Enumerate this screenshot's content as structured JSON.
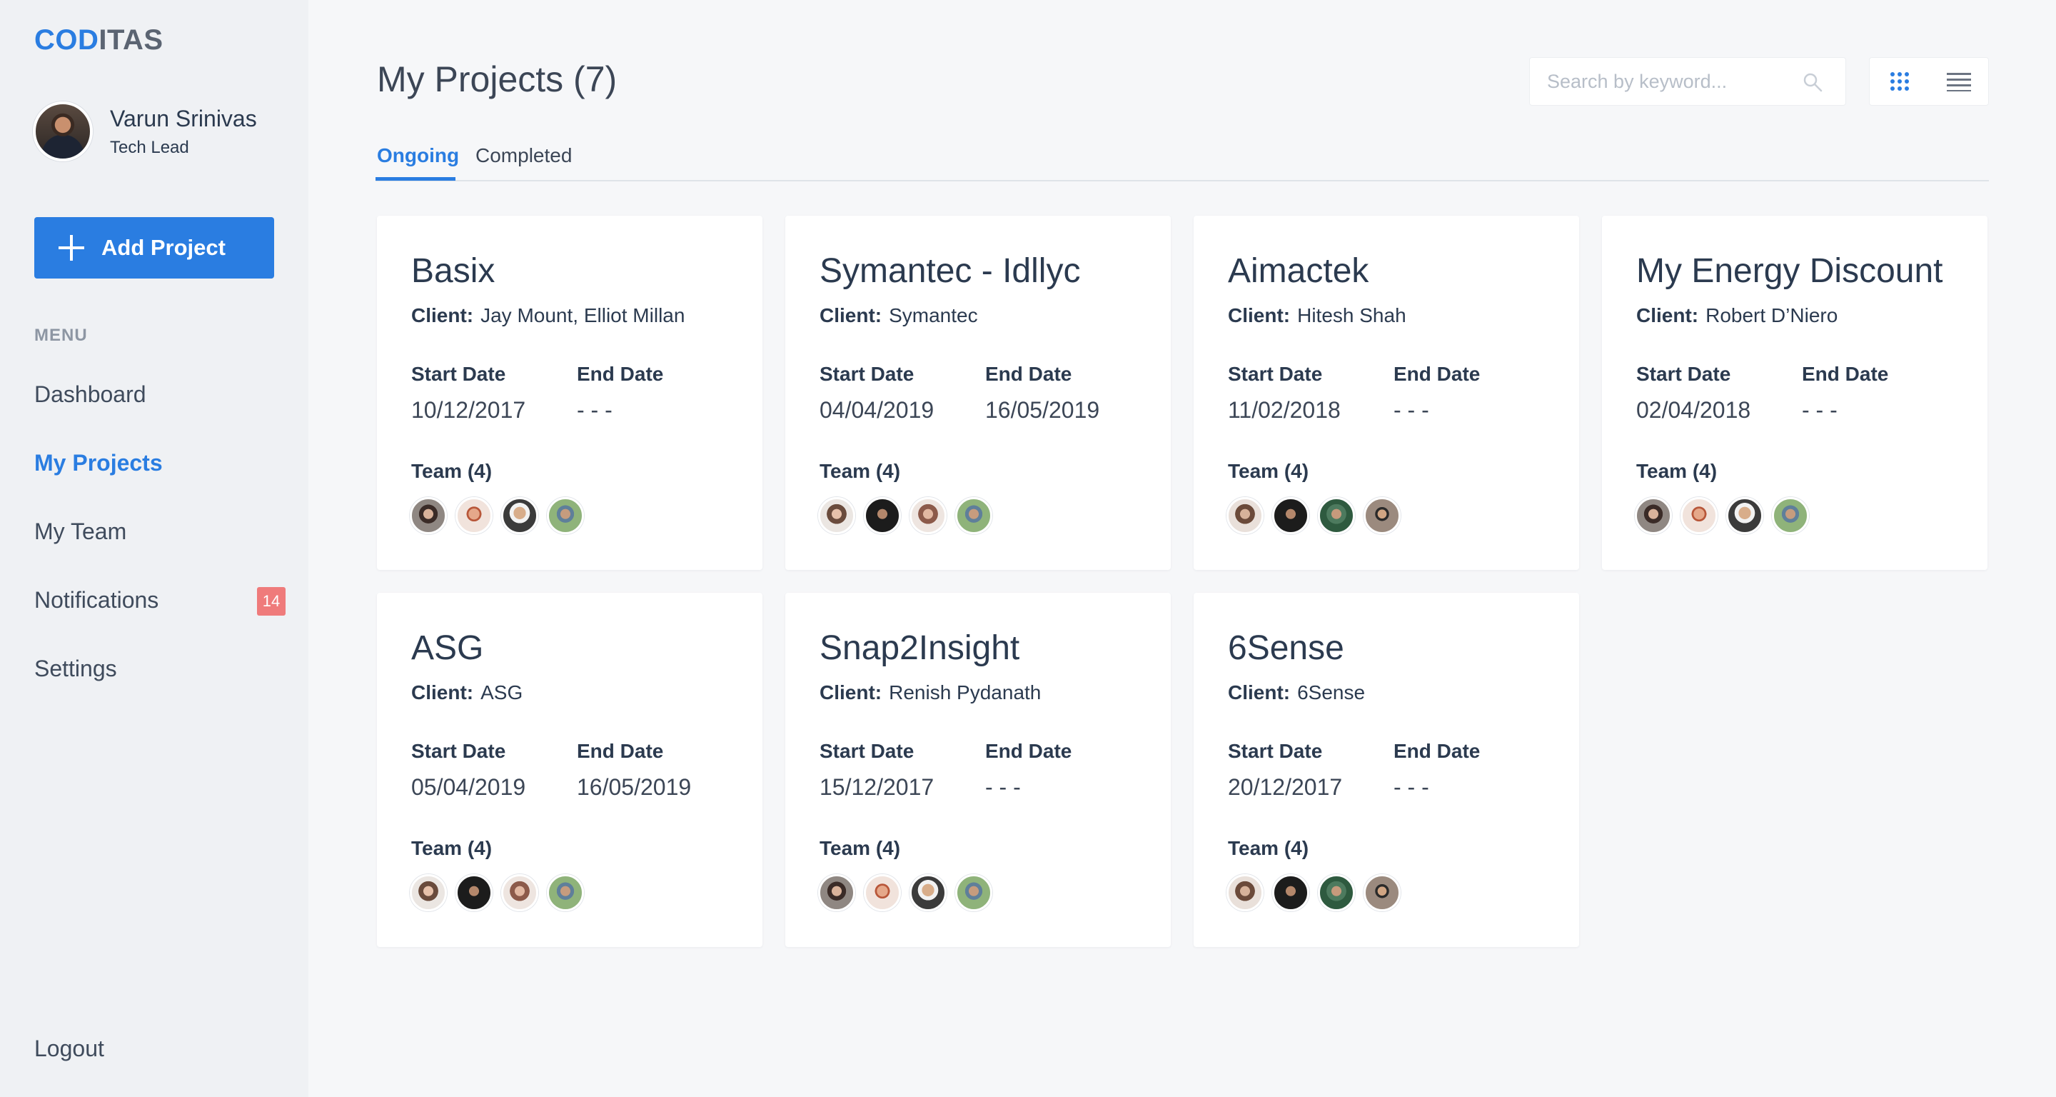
{
  "brand": {
    "part1": "COD",
    "part2": "ITAS"
  },
  "user": {
    "name": "Varun Srinivas",
    "role": "Tech Lead"
  },
  "sidebar": {
    "add_project_label": "Add Project",
    "menu_heading": "MENU",
    "items": [
      {
        "label": "Dashboard"
      },
      {
        "label": "My Projects"
      },
      {
        "label": "My Team"
      },
      {
        "label": "Notifications",
        "badge": "14"
      },
      {
        "label": "Settings"
      }
    ],
    "logout_label": "Logout"
  },
  "header": {
    "title": "My Projects (7)",
    "search_placeholder": "Search by keyword..."
  },
  "tabs": [
    {
      "label": "Ongoing"
    },
    {
      "label": "Completed"
    }
  ],
  "labels": {
    "client": "Client:",
    "start_date": "Start Date",
    "end_date": "End Date",
    "team": "Team (4)"
  },
  "projects": [
    {
      "title": "Basix",
      "client": "Jay Mount, Elliot Millan",
      "start": "10/12/2017",
      "end": "- - -"
    },
    {
      "title": "Symantec - Idllyc",
      "client": "Symantec",
      "start": "04/04/2019",
      "end": "16/05/2019"
    },
    {
      "title": "Aimactek",
      "client": "Hitesh Shah",
      "start": "11/02/2018",
      "end": "- - -"
    },
    {
      "title": "My Energy Discount",
      "client": "Robert D’Niero",
      "start": "02/04/2018",
      "end": "- - -"
    },
    {
      "title": "ASG",
      "client": "ASG",
      "start": "05/04/2019",
      "end": "16/05/2019"
    },
    {
      "title": "Snap2Insight",
      "client": "Renish Pydanath",
      "start": "15/12/2017",
      "end": "- - -"
    },
    {
      "title": "6Sense",
      "client": "6Sense",
      "start": "20/12/2017",
      "end": "- - -"
    }
  ],
  "colors": {
    "accent": "#2a7de1",
    "badge": "#ef7b7b",
    "sidebar_bg": "#eff1f4"
  }
}
